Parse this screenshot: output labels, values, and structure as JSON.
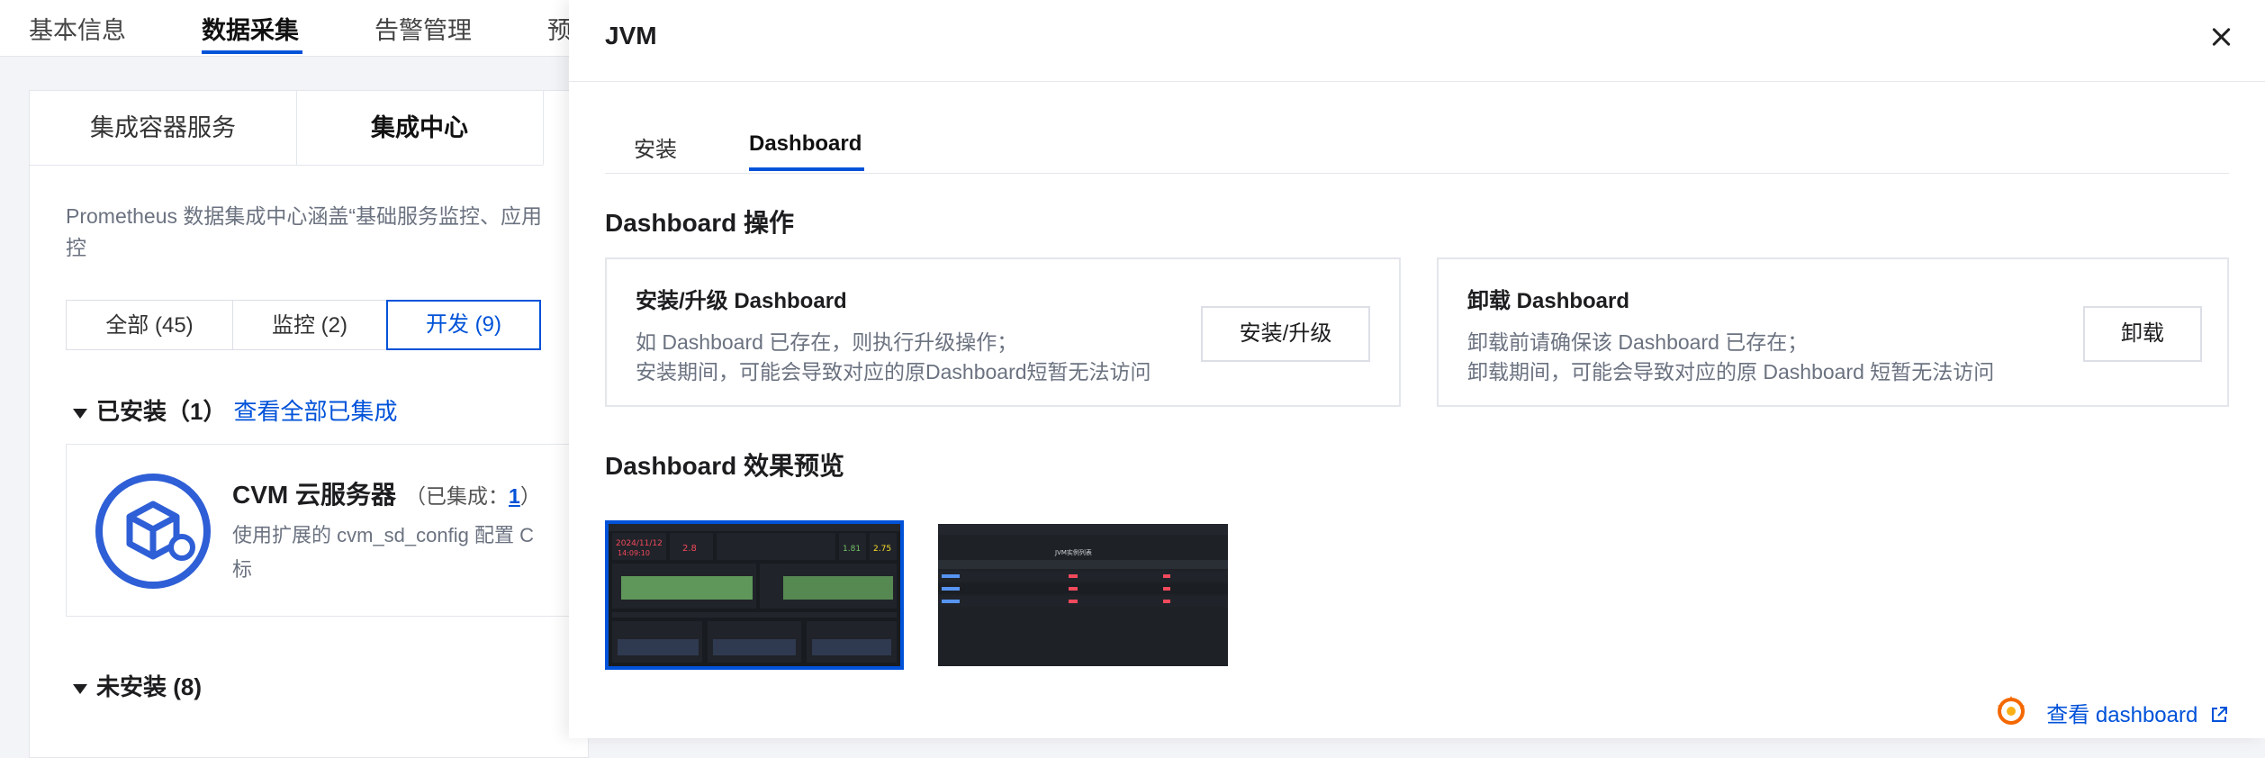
{
  "top_tabs": [
    "基本信息",
    "数据采集",
    "告警管理",
    "预"
  ],
  "sub_tabs": [
    "集成容器服务",
    "集成中心"
  ],
  "description": "Prometheus 数据集成中心涵盖“基础服务监控、应用",
  "description_line2": "控",
  "filters": [
    "全部 (45)",
    "监控 (2)",
    "开发 (9)"
  ],
  "installed": {
    "label": "已安装（1）",
    "link": "查看全部已集成"
  },
  "cvm": {
    "title": "CVM 云服务器",
    "meta_prefix": "（已集成：",
    "meta_count": "1",
    "meta_suffix": "）",
    "desc_line1": "使用扩展的 cvm_sd_config 配置 C",
    "desc_line2": "标"
  },
  "not_installed": {
    "label": "未安装 (8)"
  },
  "drawer": {
    "title": "JVM",
    "tabs": [
      "安装",
      "Dashboard"
    ],
    "ops_heading": "Dashboard 操作",
    "install_card": {
      "title": "安装/升级 Dashboard",
      "desc_line1": "如 Dashboard 已存在，则执行升级操作；",
      "desc_line2": "安装期间，可能会导致对应的原Dashboard短暂无法访问",
      "button": "安装/升级"
    },
    "uninstall_card": {
      "title": "卸载 Dashboard",
      "desc_line1": "卸载前请确保该 Dashboard 已存在；",
      "desc_line2": "卸载期间，可能会导致对应的原 Dashboard 短暂无法访问",
      "button": "卸载"
    },
    "preview_heading": "Dashboard 效果预览",
    "preview1": {
      "date": "2024/11/12",
      "time": "14:09:10",
      "v1": "2.8",
      "v2": "1.81",
      "v3": "2.75"
    },
    "preview2": {
      "header": "JVM实例列表"
    },
    "footer_link": "查看 dashboard"
  },
  "colors": {
    "accent": "#0052d9",
    "text": "#1d1d1f",
    "muted": "#6b7280",
    "border": "#e3e6eb"
  }
}
